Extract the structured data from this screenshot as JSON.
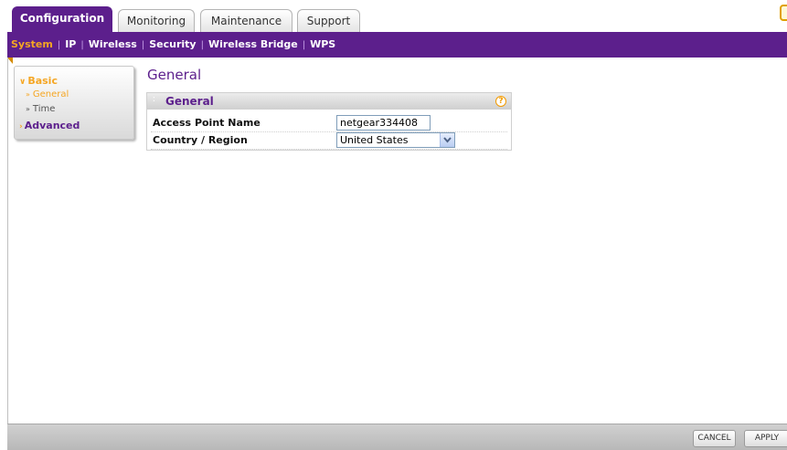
{
  "tabs": [
    {
      "label": "Configuration",
      "active": true
    },
    {
      "label": "Monitoring",
      "active": false
    },
    {
      "label": "Maintenance",
      "active": false
    },
    {
      "label": "Support",
      "active": false
    }
  ],
  "subnav": {
    "items": [
      {
        "label": "System",
        "active": true
      },
      {
        "label": "IP",
        "active": false
      },
      {
        "label": "Wireless",
        "active": false
      },
      {
        "label": "Security",
        "active": false
      },
      {
        "label": "Wireless Bridge",
        "active": false
      },
      {
        "label": "WPS",
        "active": false
      }
    ],
    "separator": "|"
  },
  "sidebar": {
    "basic": {
      "label": "Basic",
      "icon": "chevron-down-icon"
    },
    "basic_items": [
      {
        "label": "General",
        "active": true,
        "icon": "chevron-right-icon"
      },
      {
        "label": "Time",
        "active": false,
        "icon": "chevron-right-icon"
      }
    ],
    "advanced": {
      "label": "Advanced",
      "icon": "chevron-right-icon"
    }
  },
  "main": {
    "title": "General",
    "panel": {
      "title": "General",
      "help_icon": "?",
      "fields": {
        "ap_name": {
          "label": "Access Point Name",
          "value": "netgear334408"
        },
        "country": {
          "label": "Country / Region",
          "value": "United States"
        }
      }
    }
  },
  "footer": {
    "cancel_label": "CANCEL",
    "apply_label": "APPLY"
  },
  "colors": {
    "brand_purple": "#5c1f8c",
    "accent_orange": "#f5a623"
  }
}
